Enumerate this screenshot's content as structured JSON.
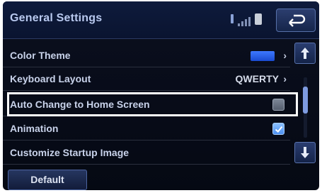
{
  "header": {
    "title": "General Settings",
    "status_icons": [
      "bluetooth-icon",
      "signal-icon",
      "battery-icon"
    ],
    "back_icon": "back-arrow-icon"
  },
  "settings": {
    "rows": [
      {
        "label": "Color Theme",
        "control": "color-swatch",
        "swatch_color": "#2f64f0",
        "chevron": "›"
      },
      {
        "label": "Keyboard Layout",
        "value": "QWERTY",
        "chevron": "›"
      },
      {
        "label": "Auto Change to Home Screen",
        "control": "checkbox",
        "checked": false,
        "highlighted": true
      },
      {
        "label": "Animation",
        "control": "checkbox",
        "checked": true
      },
      {
        "label": "Customize Startup Image"
      }
    ]
  },
  "scroll": {
    "up_icon": "arrow-up-icon",
    "down_icon": "arrow-down-icon"
  },
  "footer": {
    "default_label": "Default"
  },
  "colors": {
    "background": "#070b16",
    "accent_blue": "#2f64f0",
    "highlight_border": "#ffffff"
  }
}
